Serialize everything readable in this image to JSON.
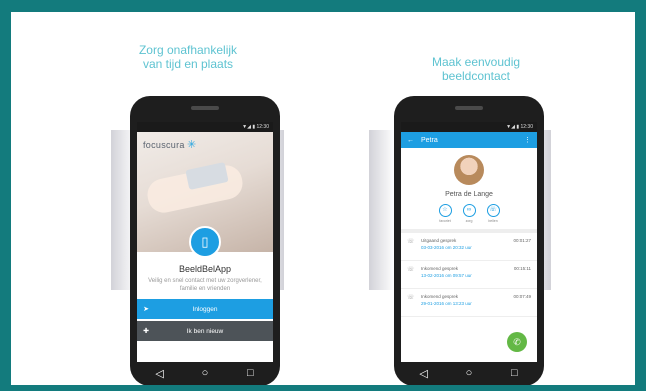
{
  "left": {
    "caption_line1": "Zorg onafhankelijk",
    "caption_line2": "van tijd en plaats",
    "status_time": "▼◢ ▮ 12:30",
    "brand": "focuscura",
    "app_title": "BeeldBelApp",
    "app_subtitle": "Veilig en snel contact met uw zorgverlener, familie en vrienden",
    "login_label": "Inloggen",
    "new_label": "Ik ben nieuw"
  },
  "right": {
    "caption_line1": "Maak eenvoudig",
    "caption_line2": "beeldcontact",
    "status_time": "▼◢ ▮ 12:30",
    "contact_short": "Petra",
    "contact_full": "Petra de Lange",
    "actions": [
      {
        "label": "favoriet"
      },
      {
        "label": "zorg"
      },
      {
        "label": "bellen"
      }
    ],
    "calls": [
      {
        "type": "Uitgaand gesprek",
        "date": "03-03-2016 om 20:32 uur",
        "duration": "00:01:27"
      },
      {
        "type": "Inkomend gesprek",
        "date": "13-02-2016 om 09:57 uur",
        "duration": "00:15:11"
      },
      {
        "type": "Inkomend gesprek",
        "date": "29-01-2016 om 13:23 uur",
        "duration": "00:07:49"
      }
    ]
  },
  "nav": {
    "back": "◁",
    "home": "○",
    "recent": "□"
  },
  "colors": {
    "frame": "#137b7d",
    "accent": "#1d9ee2",
    "caption": "#5ec3d1",
    "call_button": "#63b845"
  }
}
